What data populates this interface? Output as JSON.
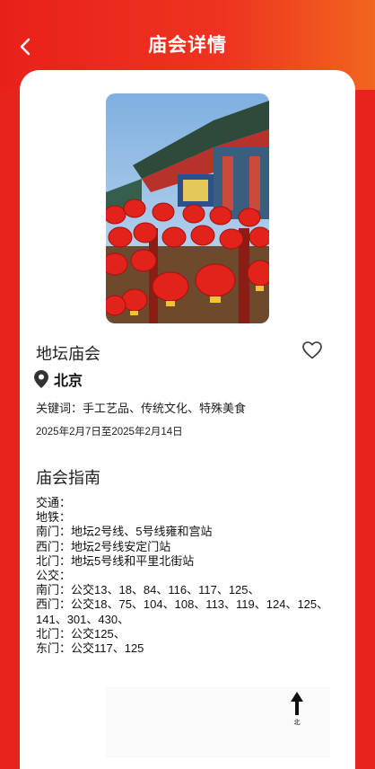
{
  "header": {
    "title": "庙会详情"
  },
  "fair": {
    "name": "地坛庙会",
    "location": "北京",
    "keywords": "关键词：手工艺品、传统文化、特殊美食",
    "date_range": "2025年2月7日至2025年2月14日"
  },
  "guide": {
    "title": "庙会指南",
    "lines": [
      "交通：",
      "地铁：",
      "南门：地坛2号线、5号线雍和宫站",
      "西门：地坛2号线安定门站",
      "北门：地坛5号线和平里北街站",
      "公交：",
      "南门：公交13、18、84、116、117、125、",
      "西门：公交18、75、104、108、113、119、124、125、",
      "141、301、430、",
      "北门：公交125、",
      "东门：公交117、125"
    ]
  },
  "map": {
    "north_label": "北"
  },
  "colors": {
    "brand_red": "#e8231d",
    "header_gradient_end": "#f2651f"
  },
  "icons": {
    "back": "chevron-left-icon",
    "favorite": "heart-outline-icon",
    "location": "map-pin-icon",
    "north": "north-arrow-icon"
  }
}
